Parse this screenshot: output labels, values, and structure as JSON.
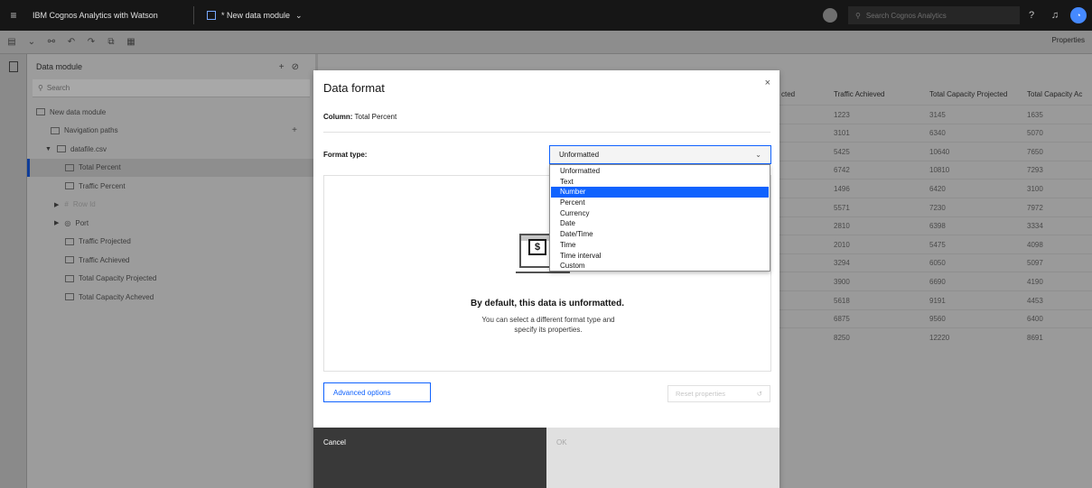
{
  "topbar": {
    "brand": "IBM Cognos Analytics with Watson",
    "module_title": "* New data module",
    "search_placeholder": "Search Cognos Analytics"
  },
  "toolbar": {
    "properties_label": "Properties"
  },
  "panel": {
    "title": "Data module",
    "search_placeholder": "Search",
    "tree": [
      {
        "label": "New data module",
        "icon": "data-module-icon",
        "indent": 0
      },
      {
        "label": "Navigation paths",
        "icon": "folder-icon",
        "indent": 1
      },
      {
        "label": "datafile.csv",
        "icon": "table-icon",
        "indent": 1
      },
      {
        "label": "Total Percent",
        "icon": "column-icon",
        "indent": 2,
        "selected": true
      },
      {
        "label": "Traffic Percent",
        "icon": "column-icon",
        "indent": 2
      },
      {
        "label": "Row Id",
        "icon": "hash-icon",
        "indent": 2
      },
      {
        "label": "Port",
        "icon": "location-icon",
        "indent": 2
      },
      {
        "label": "Traffic Projected",
        "icon": "column-icon",
        "indent": 2
      },
      {
        "label": "Traffic Achieved",
        "icon": "column-icon",
        "indent": 2
      },
      {
        "label": "Total Capacity Projected",
        "icon": "column-icon",
        "indent": 2
      },
      {
        "label": "Total Capacity Acheved",
        "icon": "column-icon",
        "indent": 2
      }
    ]
  },
  "grid": {
    "headers": [
      "cted",
      "Traffic Achieved",
      "Total Capacity Projected",
      "Total Capacity Ac"
    ],
    "rows": [
      [
        "1223",
        "3145",
        "1635"
      ],
      [
        "3101",
        "6340",
        "5070"
      ],
      [
        "5425",
        "10640",
        "7650"
      ],
      [
        "6742",
        "10810",
        "7293"
      ],
      [
        "1496",
        "6420",
        "3100"
      ],
      [
        "5571",
        "7230",
        "7972"
      ],
      [
        "2810",
        "6398",
        "3334"
      ],
      [
        "2010",
        "5475",
        "4098"
      ],
      [
        "3294",
        "6050",
        "5097"
      ],
      [
        "3900",
        "6690",
        "4190"
      ],
      [
        "5618",
        "9191",
        "4453"
      ],
      [
        "6875",
        "9560",
        "6400"
      ],
      [
        "8250",
        "12220",
        "8691"
      ]
    ]
  },
  "dialog": {
    "title": "Data format",
    "column_label": "Column:",
    "column_value": "Total Percent",
    "format_type_label": "Format type:",
    "selected_format": "Unformatted",
    "options": [
      "Unformatted",
      "Text",
      "Number",
      "Percent",
      "Currency",
      "Date",
      "Date/Time",
      "Time",
      "Time interval",
      "Custom"
    ],
    "highlighted_option": "Number",
    "message_title": "By default, this data is unformatted.",
    "message_body": "You can select a different format type and specify its properties.",
    "advanced_label": "Advanced options",
    "reset_label": "Reset properties",
    "cancel_label": "Cancel",
    "ok_label": "OK"
  }
}
